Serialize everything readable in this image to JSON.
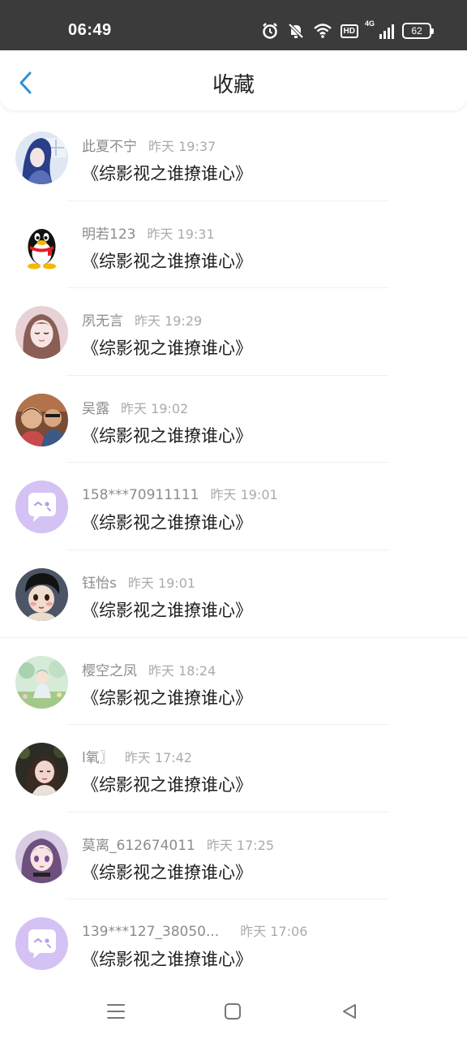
{
  "status_bar": {
    "time": "06:49",
    "network_label": "4G",
    "hd_label": "HD",
    "battery": "62"
  },
  "header": {
    "title": "收藏",
    "back_icon": "chevron-left-icon",
    "accent_color": "#2f8fd8"
  },
  "items": [
    {
      "name": "此夏不宁",
      "time": "昨天 19:37",
      "content": "《综影视之谁撩谁心》",
      "avatar": "anime-boy-avatar"
    },
    {
      "name": "明若123",
      "time": "昨天 19:31",
      "content": "《综影视之谁撩谁心》",
      "avatar": "qq-penguin-avatar"
    },
    {
      "name": "夙无言",
      "time": "昨天 19:29",
      "content": "《综影视之谁撩谁心》",
      "avatar": "girl-avatar"
    },
    {
      "name": "吴露",
      "time": "昨天 19:02",
      "content": "《综影视之谁撩谁心》",
      "avatar": "photo-avatar"
    },
    {
      "name": "158***70911111",
      "time": "昨天 19:01",
      "content": "《综影视之谁撩谁心》",
      "avatar": "default-chat-avatar"
    },
    {
      "name": "钰怡s",
      "time": "昨天 19:01",
      "content": "《综影视之谁撩谁心》",
      "avatar": "doll-avatar"
    },
    {
      "name": "樱空之凤",
      "time": "昨天 18:24",
      "content": "《综影视之谁撩谁心》",
      "avatar": "anime-garden-avatar"
    },
    {
      "name": "l氧〗",
      "time": "昨天 17:42",
      "content": "《综影视之谁撩谁心》",
      "avatar": "girl-photo-avatar"
    },
    {
      "name": "莫离_612674011",
      "time": "昨天 17:25",
      "content": "《综影视之谁撩谁心》",
      "avatar": "anime-girl-avatar"
    },
    {
      "name": "139***127_38050...",
      "time": "昨天 17:06",
      "content": "《综影视之谁撩谁心》",
      "avatar": "default-chat-avatar"
    }
  ],
  "nav_bar": {
    "menu_icon": "menu-icon",
    "home_icon": "home-square-icon",
    "back_icon": "back-triangle-icon"
  }
}
